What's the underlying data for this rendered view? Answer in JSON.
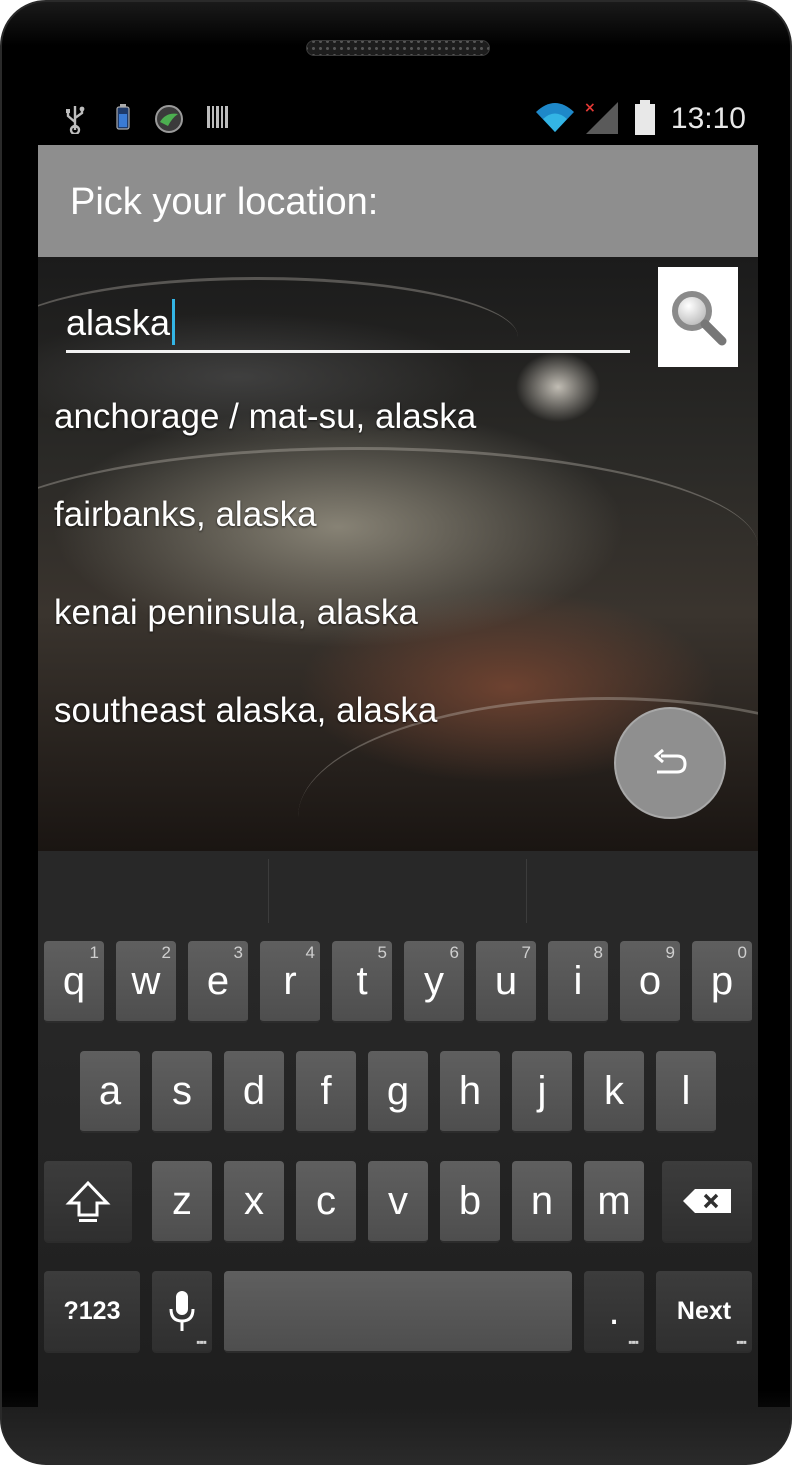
{
  "status_bar": {
    "time": "13:10",
    "icons": [
      "usb-icon",
      "battery-small-icon",
      "app-status-icon",
      "barcode-icon",
      "wifi-icon",
      "signal-icon",
      "battery-icon"
    ]
  },
  "header": {
    "title": "Pick your location:"
  },
  "search": {
    "value": "alaska",
    "button_icon": "search-icon"
  },
  "suggestions": [
    "anchorage / mat-su, alaska",
    "fairbanks, alaska",
    "kenai peninsula, alaska",
    "southeast alaska, alaska"
  ],
  "fab": {
    "icon": "undo-icon"
  },
  "keyboard": {
    "row1": [
      {
        "label": "q",
        "hint": "1"
      },
      {
        "label": "w",
        "hint": "2"
      },
      {
        "label": "e",
        "hint": "3"
      },
      {
        "label": "r",
        "hint": "4"
      },
      {
        "label": "t",
        "hint": "5"
      },
      {
        "label": "y",
        "hint": "6"
      },
      {
        "label": "u",
        "hint": "7"
      },
      {
        "label": "i",
        "hint": "8"
      },
      {
        "label": "o",
        "hint": "9"
      },
      {
        "label": "p",
        "hint": "0"
      }
    ],
    "row2": [
      "a",
      "s",
      "d",
      "f",
      "g",
      "h",
      "j",
      "k",
      "l"
    ],
    "row3": [
      "z",
      "x",
      "c",
      "v",
      "b",
      "n",
      "m"
    ],
    "symbols_label": "?123",
    "period_label": ".",
    "next_label": "Next",
    "shift_icon": "shift-icon",
    "backspace_icon": "backspace-icon",
    "mic_icon": "mic-icon"
  }
}
